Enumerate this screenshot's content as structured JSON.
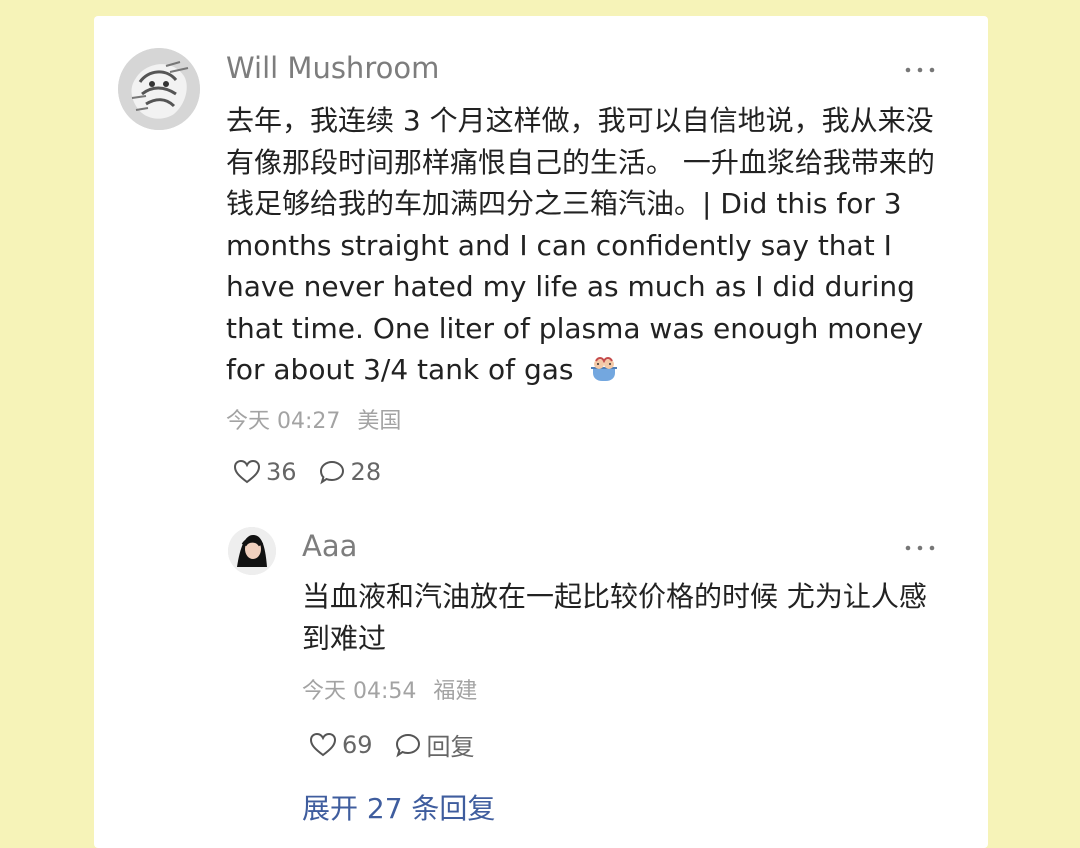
{
  "comment": {
    "username": "Will Mushroom",
    "text": "去年，我连续 3 个月这样做，我可以自信地说，我从来没有像那段时间那样痛恨自己的生活。 一升血浆给我带来的钱足够给我的车加满四分之三箱汽油。| Did this for 3 months straight and I can confidently say that I have never hated my life as much as I did during that time. One liter of plasma was enough money for about 3/4 tank of gas",
    "emoji": "bathtub-emoji",
    "time": "今天 04:27",
    "location": "美国",
    "likes": "36",
    "comments": "28"
  },
  "reply": {
    "username": "Aaa",
    "text": "当血液和汽油放在一起比较价格的时候 尤为让人感到难过",
    "time": "今天 04:54",
    "location": "福建",
    "likes": "69",
    "reply_label": "回复"
  },
  "expand_replies": "展开 27 条回复",
  "icons": {
    "more": "more-horizontal-icon",
    "like": "heart-outline-icon",
    "comment": "speech-bubble-icon"
  },
  "colors": {
    "page_background": "#f6f3b8",
    "card_background": "#ffffff",
    "username": "#7d7d7d",
    "body_text": "#222222",
    "meta_text": "#a3a3a3",
    "link_blue": "#3f5d9e"
  }
}
